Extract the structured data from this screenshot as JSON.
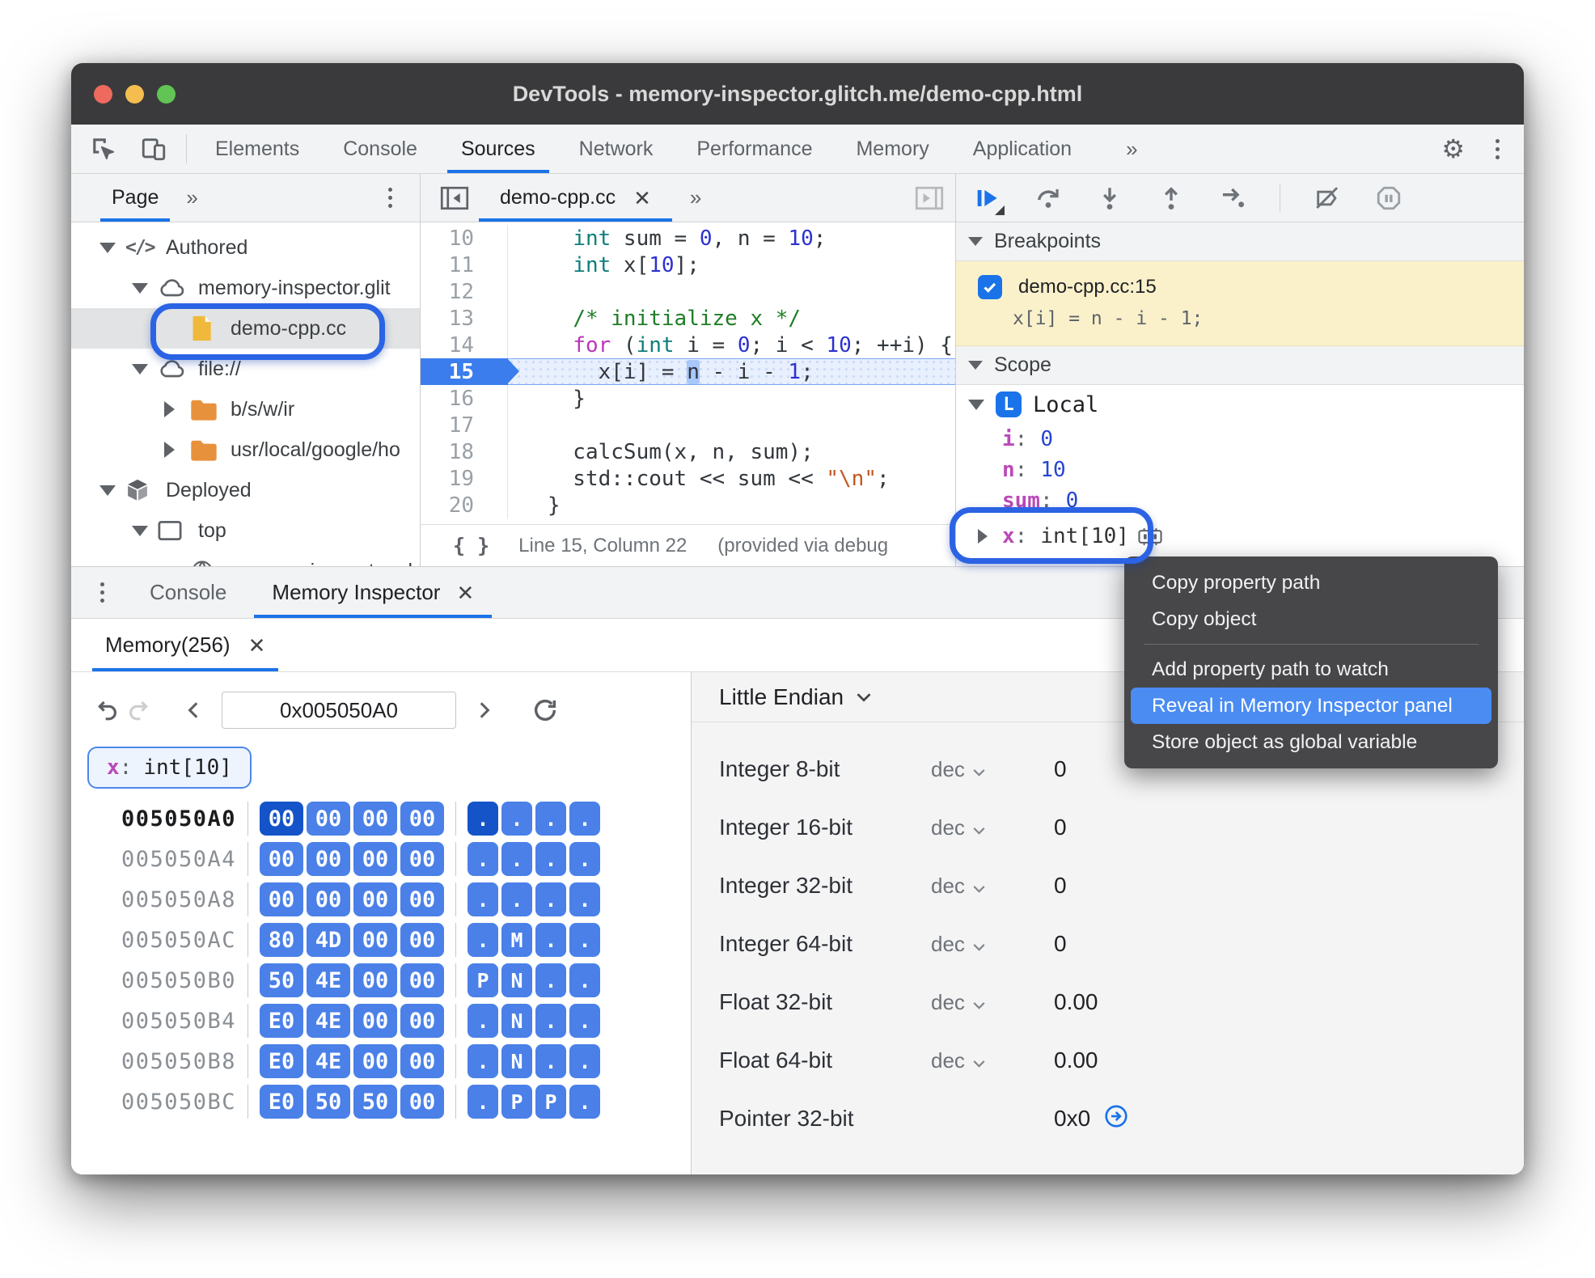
{
  "window": {
    "title": "DevTools - memory-inspector.glitch.me/demo-cpp.html"
  },
  "toolbar": {
    "tabs": [
      {
        "label": "Elements"
      },
      {
        "label": "Console"
      },
      {
        "label": "Sources",
        "active": true
      },
      {
        "label": "Network"
      },
      {
        "label": "Performance"
      },
      {
        "label": "Memory"
      },
      {
        "label": "Application"
      }
    ],
    "overflow": "»"
  },
  "sidebar": {
    "tab": "Page",
    "overflow": "»",
    "tree": [
      {
        "depth": 0,
        "arrow": "down",
        "icon": "code",
        "label": "Authored"
      },
      {
        "depth": 1,
        "arrow": "down",
        "icon": "cloud",
        "label": "memory-inspector.glit"
      },
      {
        "depth": 2,
        "arrow": null,
        "icon": "file",
        "label": "demo-cpp.cc",
        "selected": true
      },
      {
        "depth": 1,
        "arrow": "down",
        "icon": "cloud",
        "label": "file://"
      },
      {
        "depth": 2,
        "arrow": "right",
        "icon": "folder",
        "label": "b/s/w/ir"
      },
      {
        "depth": 2,
        "arrow": "right",
        "icon": "folder",
        "label": "usr/local/google/ho"
      },
      {
        "depth": 0,
        "arrow": "down",
        "icon": "package",
        "label": "Deployed"
      },
      {
        "depth": 1,
        "arrow": "down",
        "icon": "frame",
        "label": "top"
      },
      {
        "depth": 2,
        "arrow": null,
        "icon": "globe",
        "label": "memory-inspector.gl"
      }
    ]
  },
  "editor": {
    "tab": "demo-cpp.cc",
    "lines": [
      {
        "no": "10",
        "tokens": [
          [
            "  ",
            "pl"
          ],
          [
            "int",
            "kw"
          ],
          [
            " sum = ",
            "pl"
          ],
          [
            "0",
            "num"
          ],
          [
            ", n = ",
            "pl"
          ],
          [
            "10",
            "num"
          ],
          [
            ";",
            "pl"
          ]
        ]
      },
      {
        "no": "11",
        "tokens": [
          [
            "  ",
            "pl"
          ],
          [
            "int",
            "kw"
          ],
          [
            " x[",
            "pl"
          ],
          [
            "10",
            "num"
          ],
          [
            "];",
            "pl"
          ]
        ]
      },
      {
        "no": "12",
        "tokens": []
      },
      {
        "no": "13",
        "tokens": [
          [
            "  ",
            "pl"
          ],
          [
            "/* initialize x */",
            "com"
          ]
        ]
      },
      {
        "no": "14",
        "tokens": [
          [
            "  ",
            "pl"
          ],
          [
            "for",
            "kw2"
          ],
          [
            " (",
            "pl"
          ],
          [
            "int",
            "kw"
          ],
          [
            " i = ",
            "pl"
          ],
          [
            "0",
            "num"
          ],
          [
            "; i < ",
            "pl"
          ],
          [
            "10",
            "num"
          ],
          [
            "; ++i) {",
            "pl"
          ]
        ]
      },
      {
        "no": "15",
        "active": true,
        "tokens": [
          [
            "    x[i] = ",
            "pl"
          ],
          [
            "n",
            "nsel"
          ],
          [
            " - i - ",
            "pl"
          ],
          [
            "1",
            "num"
          ],
          [
            ";",
            "pl"
          ]
        ]
      },
      {
        "no": "16",
        "tokens": [
          [
            "  }",
            "pl"
          ]
        ]
      },
      {
        "no": "17",
        "tokens": []
      },
      {
        "no": "18",
        "tokens": [
          [
            "  calcSum(x, n, sum);",
            "pl"
          ]
        ]
      },
      {
        "no": "19",
        "tokens": [
          [
            "  std::cout << sum << ",
            "pl"
          ],
          [
            "\"\\n\"",
            "str"
          ],
          [
            ";",
            "pl"
          ]
        ]
      },
      {
        "no": "20",
        "tokens": [
          [
            "}",
            "pl"
          ]
        ]
      }
    ],
    "status": {
      "position": "Line 15, Column 22",
      "note": "(provided via debug"
    }
  },
  "debug": {
    "breakpoints": {
      "title": "Breakpoints",
      "items": [
        {
          "checked": true,
          "label": "demo-cpp.cc:15",
          "code": "x[i] = n - i - 1;"
        }
      ]
    },
    "scope": {
      "title": "Scope",
      "section": {
        "badge": "L",
        "label": "Local"
      },
      "entries": [
        {
          "name": "i",
          "value": "0",
          "style": "num"
        },
        {
          "name": "n",
          "value": "10",
          "style": "num"
        },
        {
          "name": "sum",
          "value": "0",
          "style": "num"
        },
        {
          "name": "x",
          "value": "int[10]",
          "style": "type",
          "expandable": true,
          "mem_icon": true
        }
      ]
    }
  },
  "context_menu": {
    "items": [
      {
        "label": "Copy property path"
      },
      {
        "label": "Copy object"
      },
      {
        "separator": true
      },
      {
        "label": "Add property path to watch"
      },
      {
        "label": "Reveal in Memory Inspector panel",
        "highlighted": true
      },
      {
        "label": "Store object as global variable"
      }
    ]
  },
  "drawer": {
    "tabs": [
      {
        "label": "Console"
      },
      {
        "label": "Memory Inspector",
        "closable": true,
        "active": true
      }
    ],
    "memory_tab": {
      "label": "Memory(256)",
      "closable": true
    }
  },
  "memory": {
    "address": "0x005050A0",
    "chip": {
      "name": "x",
      "type": "int[10]"
    },
    "rows": [
      {
        "addr": "005050A0",
        "current": true,
        "selected_index": 0,
        "bytes": [
          "00",
          "00",
          "00",
          "00"
        ],
        "ascii": [
          ".",
          ".",
          ".",
          "."
        ]
      },
      {
        "addr": "005050A4",
        "bytes": [
          "00",
          "00",
          "00",
          "00"
        ],
        "ascii": [
          ".",
          ".",
          ".",
          "."
        ]
      },
      {
        "addr": "005050A8",
        "bytes": [
          "00",
          "00",
          "00",
          "00"
        ],
        "ascii": [
          ".",
          ".",
          ".",
          "."
        ]
      },
      {
        "addr": "005050AC",
        "bytes": [
          "80",
          "4D",
          "00",
          "00"
        ],
        "ascii": [
          ".",
          "M",
          ".",
          "."
        ]
      },
      {
        "addr": "005050B0",
        "bytes": [
          "50",
          "4E",
          "00",
          "00"
        ],
        "ascii": [
          "P",
          "N",
          ".",
          "."
        ]
      },
      {
        "addr": "005050B4",
        "bytes": [
          "E0",
          "4E",
          "00",
          "00"
        ],
        "ascii": [
          ".",
          "N",
          ".",
          "."
        ]
      },
      {
        "addr": "005050B8",
        "bytes": [
          "E0",
          "4E",
          "00",
          "00"
        ],
        "ascii": [
          ".",
          "N",
          ".",
          "."
        ]
      },
      {
        "addr": "005050BC",
        "bytes": [
          "E0",
          "50",
          "50",
          "00"
        ],
        "ascii": [
          ".",
          "P",
          "P",
          "."
        ]
      }
    ],
    "endianness": "Little Endian",
    "interpretations": [
      {
        "label": "Integer 8-bit",
        "mode": "dec",
        "value": "0"
      },
      {
        "label": "Integer 16-bit",
        "mode": "dec",
        "value": "0"
      },
      {
        "label": "Integer 32-bit",
        "mode": "dec",
        "value": "0"
      },
      {
        "label": "Integer 64-bit",
        "mode": "dec",
        "value": "0"
      },
      {
        "label": "Float 32-bit",
        "mode": "dec",
        "value": "0.00"
      },
      {
        "label": "Float 64-bit",
        "mode": "dec",
        "value": "0.00"
      },
      {
        "label": "Pointer 32-bit",
        "mode": null,
        "value": "0x0",
        "jump": true
      }
    ]
  },
  "colors": {
    "accent": "#1a73e8",
    "hex_cell": "#4a80e8",
    "hex_cell_selected": "#1553c9",
    "breakpoint_bg": "#faf1cb",
    "menu_highlight": "#4a8cf2",
    "callout_ring": "#2b63e4"
  }
}
